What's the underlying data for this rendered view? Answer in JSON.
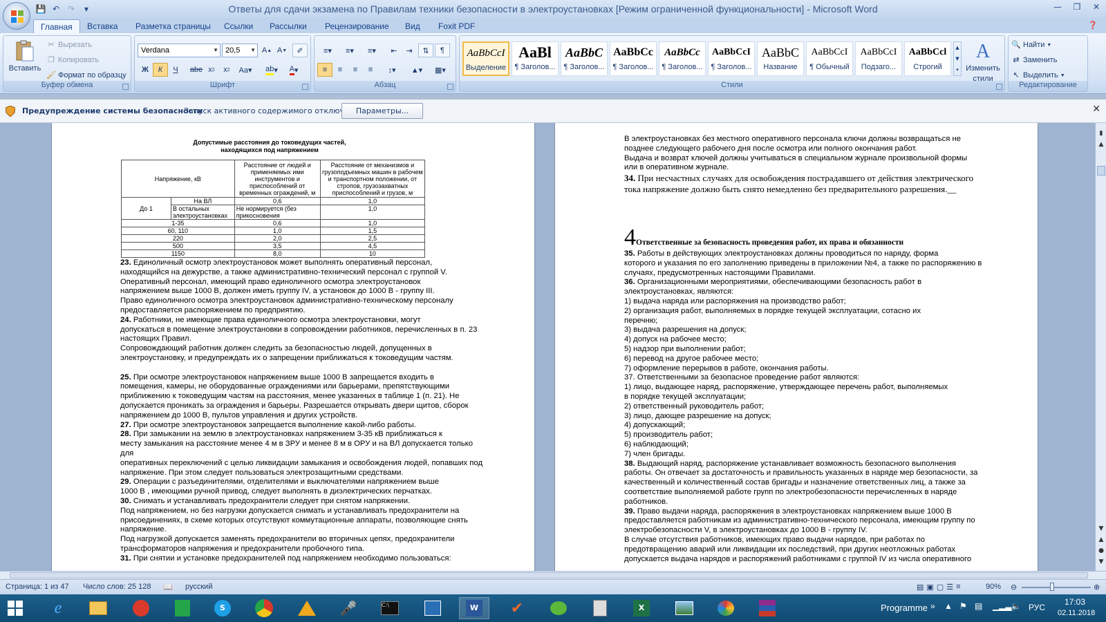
{
  "window": {
    "title": "Ответы для сдачи экзамена по Правилам техники безопасности в электроустановках [Режим ограниченной функциональности] - Microsoft Word"
  },
  "tabs": [
    "Главная",
    "Вставка",
    "Разметка страницы",
    "Ссылки",
    "Рассылки",
    "Рецензирование",
    "Вид",
    "Foxit PDF"
  ],
  "clipboard": {
    "paste": "Вставить",
    "cut": "Вырезать",
    "copy": "Копировать",
    "format_painter": "Формат по образцу",
    "label": "Буфер обмена"
  },
  "font": {
    "name": "Verdana",
    "size": "20,5",
    "label": "Шрифт"
  },
  "paragraph": {
    "label": "Абзац"
  },
  "styles": {
    "label": "Стили",
    "items": [
      {
        "sample": "AaBbCcI",
        "name": "Выделение"
      },
      {
        "sample": "AaBl",
        "name": "¶ Заголов..."
      },
      {
        "sample": "AaBbC",
        "name": "¶ Заголов..."
      },
      {
        "sample": "AaBbCc",
        "name": "¶ Заголов..."
      },
      {
        "sample": "AaBbCc",
        "name": "¶ Заголов..."
      },
      {
        "sample": "AaBbCcI",
        "name": "¶ Заголов..."
      },
      {
        "sample": "AaBbC",
        "name": "Название"
      },
      {
        "sample": "AaBbCcI",
        "name": "¶ Обычный"
      },
      {
        "sample": "AaBbCcI",
        "name": "Подзаго..."
      },
      {
        "sample": "AaBbCcl",
        "name": "Строгий"
      }
    ],
    "change_line1": "Изменить",
    "change_line2": "стили"
  },
  "editing": {
    "find": "Найти",
    "replace": "Заменить",
    "select": "Выделить",
    "label": "Редактирование"
  },
  "security_bar": {
    "title": "Предупреждение системы безопасности",
    "message": "Запуск активного содержимого отключен.",
    "button": "Параметры..."
  },
  "left_page": {
    "table_title_line1": "Допустимые расстояния до токоведущих частей,",
    "table_title_line2": "находящихся под напряжением",
    "table": {
      "h_voltage": "Напряжение, кВ",
      "h_people": "Расстояние от людей и применяемых ими инструментов и приспособлений от временных ограждений, м",
      "h_mech": "Расстояние от механизмов и грузоподъемных машин в рабочем и транспортном положении, от стропов, грузозахватных приспособлений и грузов, м",
      "upto1": "До 1",
      "on_vl": "На ВЛ",
      "other": "В остальных электроустановках",
      "r1": [
        "0,6",
        "1,0"
      ],
      "r2": [
        "Не нормируется (без прикосновения",
        "1,0"
      ],
      "rows": [
        [
          "1-35",
          "0,6",
          "1,0"
        ],
        [
          "60, 110",
          "1,0",
          "1,5"
        ],
        [
          "220",
          "2,0",
          "2,5"
        ],
        [
          "500",
          "3,5",
          "4,5"
        ],
        [
          "1150",
          "8,0",
          "10"
        ]
      ]
    },
    "p23_num": "23.",
    "p23": "Единоличный осмотр электроустановок может выполнять оперативный персонал,",
    "p23_lines": [
      "находящийся на дежурстве, а также административно-технический персонал с группой V.",
      "Оперативный персонал, имеющий право единоличного осмотра электроустановок",
      "напряжением выше 1000 В, должен иметь группу IV, а установок до 1000 В - группу III.",
      "Право единоличного осмотра электроустановок административно-техническому персоналу",
      "предоставляется распоряжением по предприятию."
    ],
    "p24_num": "24.",
    "p24": "Работники, не имеющие права единоличного осмотра электроустановки, могут",
    "p24_lines": [
      "допускаться в помещение электроустановки в сопровождении работников, перечисленных в п. 23",
      "настоящих Правил.",
      "Сопровождающий работник должен следить за безопасностью людей, допущенных в",
      "электроустановку, и предупреждать их о запрещении приближаться к токоведущим частям."
    ],
    "p25_num": "25.",
    "p25": "При осмотре электроустановок напряжением выше 1000 В запрещается входить в",
    "p25_lines": [
      "помещения, камеры, не оборудованные ограждениями или барьерами, препятствующими",
      "приближению к токоведущим частям на расстояния, менее указанных в таблице 1 (п. 21). Не",
      "допускается проникать за ограждения и барьеры. Разрешается открывать двери щитов, сборок",
      "напряжением до 1000 В, пультов управления и других устройств."
    ],
    "p27_num": "27.",
    "p27": "При осмотре электроустановок запрещается выполнение какой-либо работы.",
    "p28_num": "28.",
    "p28": "При замыкании на землю в электроустановках напряжением 3-35 кВ приближаться к",
    "p28_lines": [
      "месту замыкания на расстояние менее 4 м в ЗРУ  и менее 8 м в ОРУ и на ВЛ допускается только",
      "для",
      "оперативных переключений с целью ликвидации замыкания и освобождения людей, попавших под",
      "напряжение. При этом следует пользоваться электрозащитными средствами."
    ],
    "p29_num": "29.",
    "p29": "Операции с разъединителями, отделителями и выключателями напряжением выше",
    "p29_lines": [
      "1000 В , имеющими ручной привод, следует выполнять в диэлектрических перчатках."
    ],
    "p30_num": "30.",
    "p30": "Снимать и устанавливать предохранители следует при снятом напряжении.",
    "p30_lines": [
      "Под напряжением, но без нагрузки допускается снимать и устанавливать предохранители на",
      "присоединениях, в схеме которых отсутствуют коммутационные аппараты, позволяющие снять",
      "напряжение.",
      "Под нагрузкой допускается заменять предохранители во вторичных цепях, предохранители",
      "трансформаторов напряжения и предохранители пробочного типа."
    ],
    "p31_num": "31.",
    "p31": "При снятии и установке предохранителей под напряжением необходимо пользоваться:"
  },
  "right_page": {
    "top_lines": [
      "В электроустановках без местного оперативного персонала ключи должны возвращаться не",
      "позднее следующего рабочего дня после осмотра или полного окончания работ.",
      "Выдача и возврат ключей должны учитываться в специальном журнале произвольной формы",
      "или в оперативном журнале."
    ],
    "p34_num": "34.",
    "p34_line1": "При несчастных случаях для освобождения пострадавшего от действия электрического",
    "p34_line2": "тока напряжение должно быть снято немедленно без предварительного разрешения.__",
    "heading_num": "4",
    "heading": "Ответственные за безопасность проведения работ, их права и обязанности",
    "p35_num": "35.",
    "p35": "Работы в действующих электроустановках должны проводиться по наряду, форма",
    "p35_lines": [
      "которого и указания по его заполнению приведены в приложении №4, а также по распоряжению в",
      "случаях, предусмотренных настоящими Правилами."
    ],
    "p36_num": "36.",
    "p36": "Организационными мероприятиями, обеспечивающими безопасность работ в",
    "p36_lines": [
      "электроустановках, являются:",
      "1) выдача наряда или распоряжения на производство работ;",
      "2) организация работ, выполняемых в порядке текущей эксплуатации, сотасно их",
      "перечню;",
      "3) выдача разрешения на допуск;",
      "4) допуск на рабочее место;",
      "5) надзор при выполнении работ;",
      "6) перевод на другое рабочее место;",
      "7) оформление перерывов в работе, окончания работы.",
      "37. Ответственными за безопасное проведение работ являются:",
      "1) лицо, выдающее наряд, распоряжение, утверждающее перечень работ, выполняемых",
      "в порядке текущей эксплуатации;",
      "2) ответственный руководитель работ;",
      "3) лицо, дающее разрешение на допуск;",
      "4) допускающий;",
      "5) производитель работ;",
      "6) наблюдающий;",
      "7) член бригады."
    ],
    "p38_num": "38.",
    "p38": "Выдающий наряд, распоряжение устанавливает возможность безопасного выполнения",
    "p38_lines": [
      "работы. Он отвечает за достаточность и правильность указанных в наряде мер безопасности, за",
      "качественный и количественный состав бригады и назначение ответственных лиц, а также за",
      "соответствие выполняемой работе групп по электробезопасности перечисленных в наряде",
      "работников."
    ],
    "p39_num": "39.",
    "p39": "Право выдачи наряда, распоряжения в электроустановках напряжением выше 1000 В",
    "p39_lines": [
      "предоставляется работникам из административно-технического персонала, имеющим группу по",
      "электробезопасности V, в электроустановках до 1000 В - группу IV.",
      "В случае отсутствия работников, имеющих право выдачи нарядов, при работах по",
      "предотвращению аварий или ликвидации их последствий, при других неотложных работах",
      "допускается выдача нарядов и распоряжений работниками с группой IV из числа оперативного"
    ]
  },
  "status": {
    "page": "Страница: 1 из 47",
    "words": "Число слов: 25 128",
    "lang": "русский",
    "zoom": "90%"
  },
  "taskbar": {
    "programme": "Programme",
    "lang": "РУС",
    "time": "17:03",
    "date": "02.11.2018"
  }
}
